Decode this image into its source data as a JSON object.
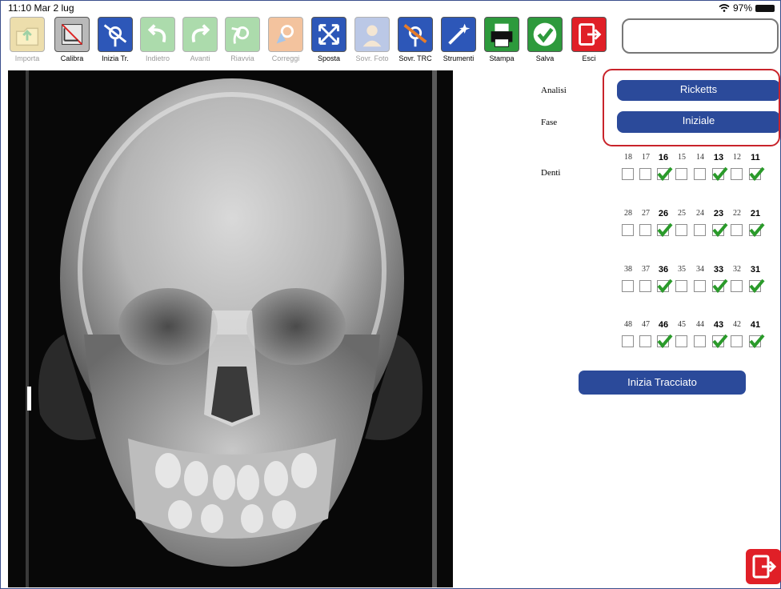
{
  "status": {
    "time_date": "11:10  Mar 2 lug",
    "battery": "97%"
  },
  "toolbar": [
    {
      "key": "importa",
      "label": "Importa",
      "enabled": false,
      "color": "#d9b848",
      "icon": "folder-import-icon"
    },
    {
      "key": "calibra",
      "label": "Calibra",
      "enabled": true,
      "color": "#b9b9b9",
      "icon": "ruler-calibrate-icon"
    },
    {
      "key": "inizia_tr",
      "label": "Inizia Tr.",
      "enabled": true,
      "color": "#2d57b8",
      "icon": "trace-start-icon"
    },
    {
      "key": "indietro",
      "label": "Indietro",
      "enabled": false,
      "color": "#48b04a",
      "icon": "undo-arrow-icon"
    },
    {
      "key": "avanti",
      "label": "Avanti",
      "enabled": false,
      "color": "#48b04a",
      "icon": "redo-arrow-icon"
    },
    {
      "key": "riavvia",
      "label": "Riavvia",
      "enabled": false,
      "color": "#48b04a",
      "icon": "restart-icon"
    },
    {
      "key": "correggi",
      "label": "Correggi",
      "enabled": false,
      "color": "#e67c2a",
      "icon": "correct-cursor-icon"
    },
    {
      "key": "sposta",
      "label": "Sposta",
      "enabled": true,
      "color": "#2d57b8",
      "icon": "move-arrows-icon"
    },
    {
      "key": "sovr_foto",
      "label": "Sovr. Foto",
      "enabled": false,
      "color": "#6b86c8",
      "icon": "photo-overlay-icon"
    },
    {
      "key": "sovr_trc",
      "label": "Sovr. TRC",
      "enabled": true,
      "color": "#2d57b8",
      "icon": "trace-overlay-icon"
    },
    {
      "key": "strumenti",
      "label": "Strumenti",
      "enabled": true,
      "color": "#2d57b8",
      "icon": "magic-wand-icon"
    },
    {
      "key": "stampa",
      "label": "Stampa",
      "enabled": true,
      "color": "#2d9a3c",
      "icon": "printer-icon"
    },
    {
      "key": "salva",
      "label": "Salva",
      "enabled": true,
      "color": "#2d9a3c",
      "icon": "checkmark-save-icon"
    },
    {
      "key": "esci",
      "label": "Esci",
      "enabled": true,
      "color": "#e01f27",
      "icon": "exit-door-icon"
    }
  ],
  "panel": {
    "analisi_label": "Analisi",
    "analisi_value": "Ricketts",
    "fase_label": "Fase",
    "fase_value": "Iniziale",
    "denti_label": "Denti",
    "start_button": "Inizia Tracciato"
  },
  "teeth_rows": [
    {
      "numbers": [
        "18",
        "17",
        "16",
        "15",
        "14",
        "13",
        "12",
        "11"
      ],
      "checked": [
        false,
        false,
        true,
        false,
        false,
        true,
        false,
        true
      ]
    },
    {
      "numbers": [
        "28",
        "27",
        "26",
        "25",
        "24",
        "23",
        "22",
        "21"
      ],
      "checked": [
        false,
        false,
        true,
        false,
        false,
        true,
        false,
        true
      ]
    },
    {
      "numbers": [
        "38",
        "37",
        "36",
        "35",
        "34",
        "33",
        "32",
        "31"
      ],
      "checked": [
        false,
        false,
        true,
        false,
        false,
        true,
        false,
        true
      ]
    },
    {
      "numbers": [
        "48",
        "47",
        "46",
        "45",
        "44",
        "43",
        "42",
        "41"
      ],
      "checked": [
        false,
        false,
        true,
        false,
        false,
        true,
        false,
        true
      ]
    }
  ],
  "colors": {
    "accent_blue": "#2b4a9a",
    "highlight_red": "#c9242b",
    "check_green": "#2a9a2a"
  }
}
